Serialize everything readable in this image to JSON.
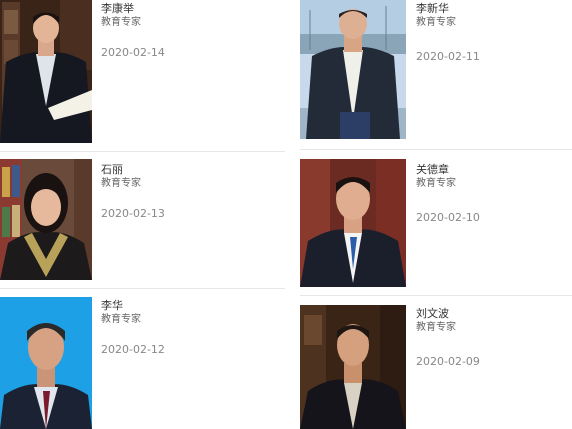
{
  "experts": [
    {
      "name": "李康举",
      "title": "教育专家",
      "date": "2020-02-14"
    },
    {
      "name": "李新华",
      "title": "教育专家",
      "date": "2020-02-11"
    },
    {
      "name": "石丽",
      "title": "教育专家",
      "date": "2020-02-13"
    },
    {
      "name": "关德章",
      "title": "教育专家",
      "date": "2020-02-10"
    },
    {
      "name": "李华",
      "title": "教育专家",
      "date": "2020-02-12"
    },
    {
      "name": "刘文波",
      "title": "教育专家",
      "date": "2020-02-09"
    }
  ]
}
